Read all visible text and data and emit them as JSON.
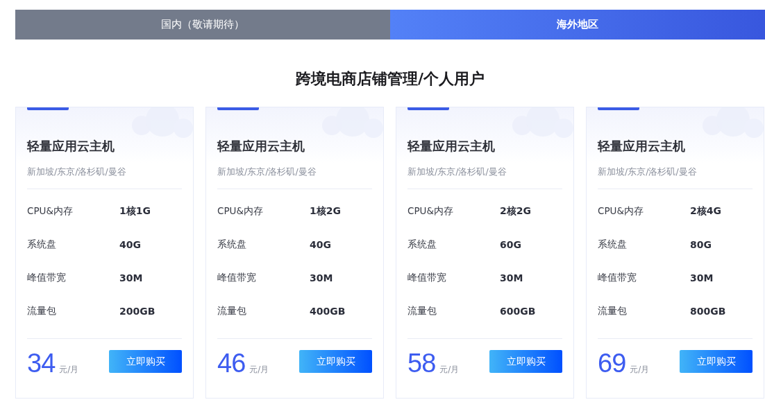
{
  "tabs": [
    {
      "label": "国内（敬请期待）",
      "selected": false
    },
    {
      "label": "海外地区",
      "selected": true
    }
  ],
  "heading": "跨境电商店铺管理/个人用户",
  "plans": [
    {
      "title": "轻量应用云主机",
      "regions": "新加坡/东京/洛杉矶/曼谷",
      "specs": [
        {
          "label": "CPU&内存",
          "value": "1核1G"
        },
        {
          "label": "系统盘",
          "value": "40G"
        },
        {
          "label": "峰值带宽",
          "value": "30M"
        },
        {
          "label": "流量包",
          "value": "200GB"
        }
      ],
      "price": "34",
      "unit": "元/月",
      "button": "立即购买"
    },
    {
      "title": "轻量应用云主机",
      "regions": "新加坡/东京/洛杉矶/曼谷",
      "specs": [
        {
          "label": "CPU&内存",
          "value": "1核2G"
        },
        {
          "label": "系统盘",
          "value": "40G"
        },
        {
          "label": "峰值带宽",
          "value": "30M"
        },
        {
          "label": "流量包",
          "value": "400GB"
        }
      ],
      "price": "46",
      "unit": "元/月",
      "button": "立即购买"
    },
    {
      "title": "轻量应用云主机",
      "regions": "新加坡/东京/洛杉矶/曼谷",
      "specs": [
        {
          "label": "CPU&内存",
          "value": "2核2G"
        },
        {
          "label": "系统盘",
          "value": "60G"
        },
        {
          "label": "峰值带宽",
          "value": "30M"
        },
        {
          "label": "流量包",
          "value": "600GB"
        }
      ],
      "price": "58",
      "unit": "元/月",
      "button": "立即购买"
    },
    {
      "title": "轻量应用云主机",
      "regions": "新加坡/东京/洛杉矶/曼谷",
      "specs": [
        {
          "label": "CPU&内存",
          "value": "2核4G"
        },
        {
          "label": "系统盘",
          "value": "80G"
        },
        {
          "label": "峰值带宽",
          "value": "30M"
        },
        {
          "label": "流量包",
          "value": "800GB"
        }
      ],
      "price": "69",
      "unit": "元/月",
      "button": "立即购买"
    }
  ]
}
